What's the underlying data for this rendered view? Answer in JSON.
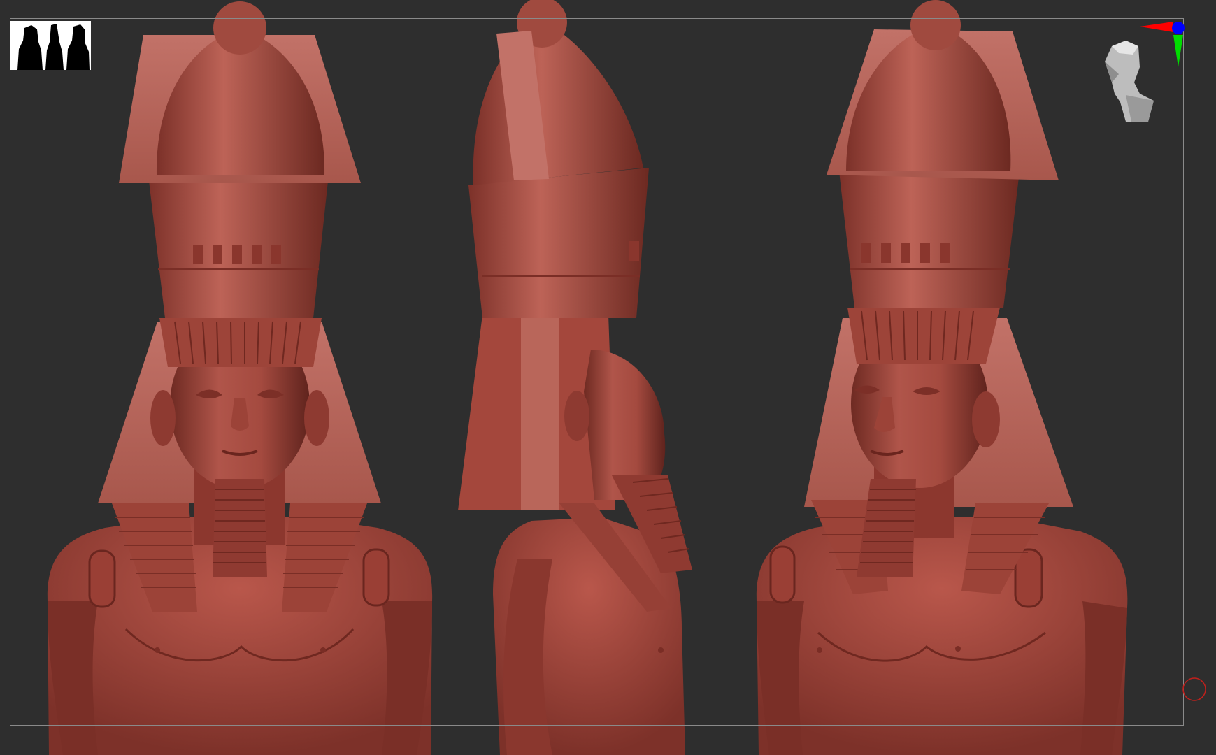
{
  "viewport": {
    "background_color": "#2e2e2e",
    "frame_color": "#8a8a8a"
  },
  "model": {
    "material_color": "#a4473c",
    "views": [
      "front",
      "side",
      "three-quarter"
    ]
  },
  "thumbnail": {
    "icon": "silhouette-thumbnail-icon"
  },
  "gizmo": {
    "icon": "orientation-head-icon",
    "axis_colors": {
      "x": "#ff0000",
      "y": "#00dd00",
      "z": "#0000ff"
    }
  },
  "floor_indicator": {
    "icon": "floor-circle-icon",
    "color": "#c0201c"
  }
}
